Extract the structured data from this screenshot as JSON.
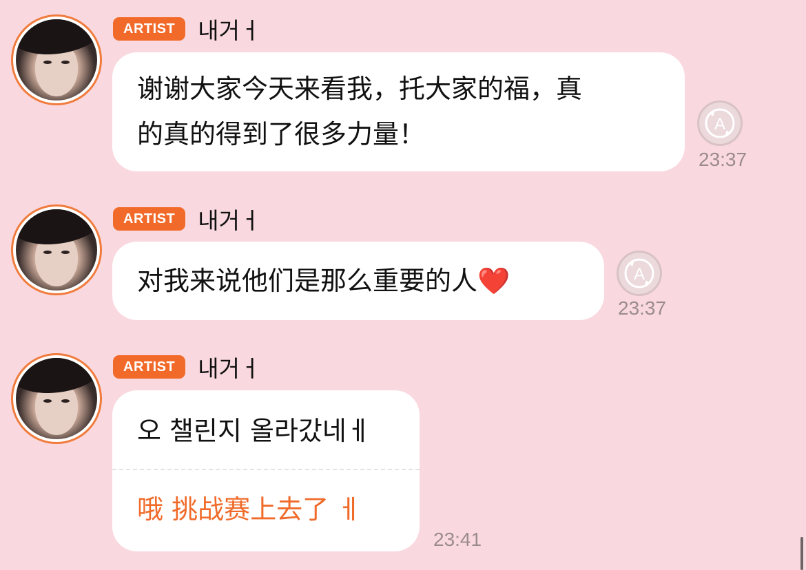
{
  "messages": [
    {
      "badge": "ARTIST",
      "username": "내거ㅓ",
      "text": "谢谢大家今天来看我，托大家的福，真的真的得到了很多力量！",
      "line1": "谢谢大家今天来看我，托大家的福，真",
      "line2": "的真的得到了很多力量！",
      "time": "23:37"
    },
    {
      "badge": "ARTIST",
      "username": "내거ㅓ",
      "text": "对我来说他们是那么重要的人❤️",
      "time": "23:37"
    },
    {
      "badge": "ARTIST",
      "username": "내거ㅓ",
      "text": "오 챌린지 올라갔네ㅔ",
      "translation": "哦 挑战赛上去了 ㅔ",
      "time": "23:41"
    }
  ],
  "colors": {
    "background": "#f9d9df",
    "badge": "#f26a2a",
    "translation_text": "#f06b2a",
    "bubble": "#ffffff",
    "timestamp": "#9b8b8e"
  },
  "icons": {
    "translate": "translate-a-icon"
  }
}
